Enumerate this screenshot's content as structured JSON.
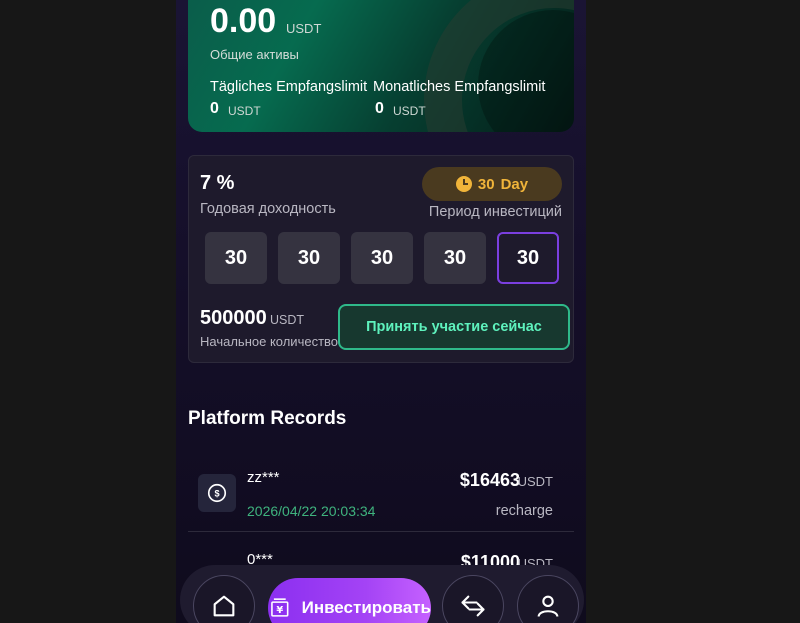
{
  "balance": {
    "amount": "0.00",
    "unit": "USDT",
    "label": "Общие активы",
    "daily_limit_label": "Tägliches Empfangslimit",
    "monthly_limit_label": "Monatliches Empfangslimit",
    "daily_value": "0",
    "daily_unit": "USDT",
    "monthly_value": "0",
    "monthly_unit": "USDT"
  },
  "invest": {
    "rate": "7  %",
    "rate_label": "Годовая доходность",
    "period_value": "30",
    "period_unit": "Day",
    "period_label": "Период инвестиций",
    "day_options": [
      "30",
      "30",
      "30",
      "30",
      "30"
    ],
    "selected_index": 4,
    "amount": "500000",
    "amount_unit": "USDT",
    "amount_label": "Начальное количество",
    "join_label": "Принять участие сейчас"
  },
  "records": {
    "title": "Platform Records",
    "items": [
      {
        "user": "zz***",
        "time": "2026/04/22 20:03:34",
        "amount": "$16463",
        "unit": "USDT",
        "type": "recharge"
      },
      {
        "user": "0***",
        "time": "",
        "amount": "$11000",
        "unit": "USDT",
        "type": ""
      }
    ]
  },
  "nav": {
    "invest_label": "Инвестировать",
    "icons": [
      "home-icon",
      "invest-icon",
      "exchange-icon",
      "profile-icon"
    ]
  },
  "colors": {
    "accent_purple": "#8b2ff0",
    "green": "#2fb98a",
    "gold": "#f0b43a"
  }
}
